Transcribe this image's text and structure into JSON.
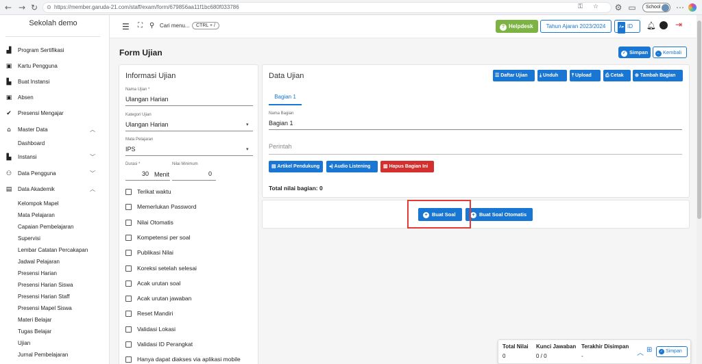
{
  "browser": {
    "url": "https://member.garuda-21.com/staff/exam/form/679856aa11f1bc680f033786",
    "profile_label": "School"
  },
  "sidebar": {
    "brand": "Sekolah demo",
    "items": [
      {
        "label": "Program Sertifikasi",
        "icon": "certificate-icon"
      },
      {
        "label": "Kartu Pengguna",
        "icon": "id-card-icon"
      },
      {
        "label": "Buat Instansi",
        "icon": "building-icon"
      },
      {
        "label": "Absen",
        "icon": "id-card-icon"
      },
      {
        "label": "Presensi Mengajar",
        "icon": "check-circle-icon"
      },
      {
        "label": "Master Data",
        "icon": "home-icon",
        "expanded": true
      },
      {
        "label": "Dashboard",
        "sub": true
      },
      {
        "label": "Instansi",
        "icon": "building-icon",
        "expanded": false
      },
      {
        "label": "Data Pengguna",
        "icon": "users-icon",
        "expanded": false
      },
      {
        "label": "Data Akademik",
        "icon": "book-icon",
        "expanded": true
      }
    ],
    "academic_sub": [
      "Kelompok Mapel",
      "Mata Pelajaran",
      "Capaian Pembelajaran",
      "Supervisi",
      "Lembar Catatan Percakapan",
      "Jadwal Pelajaran",
      "Presensi Harian",
      "Presensi Harian Siswa",
      "Presensi Harian Staff",
      "Presensi Mapel Siswa",
      "Materi Belajar",
      "Tugas Belajar",
      "Ujian",
      "Jurnal Pembelajaran"
    ]
  },
  "header": {
    "search_label": "Cari menu...",
    "shortcut": "CTRL + /",
    "helpdesk": "Helpdesk",
    "academic_year": "Tahun Ajaran 2023/2024",
    "lang": "ID"
  },
  "page": {
    "title": "Form Ujian",
    "save": "Simpan",
    "back": "Kembali"
  },
  "info": {
    "title": "Informasi Ujian",
    "nama_label": "Nama Ujian *",
    "nama_value": "Ulangan Harian",
    "kategori_label": "Kategori Ujian",
    "kategori_value": "Ulangan Harian",
    "mapel_label": "Mata Pelajaran",
    "mapel_value": "IPS",
    "durasi_label": "Durasi *",
    "durasi_value": "30",
    "durasi_unit": "Menit",
    "nilai_min_label": "Nilai Minimum",
    "nilai_min_value": "0",
    "checkboxes": [
      "Terikat waktu",
      "Memerlukan Password",
      "Nilai Otomatis",
      "Kompetensi per soal",
      "Publikasi Nilai",
      "Koreksi setelah selesai",
      "Acak urutan soal",
      "Acak urutan jawaban",
      "Reset Mandiri",
      "Validasi Lokasi",
      "Validasi ID Perangkat",
      "Hanya dapat diakses via aplikasi mobile"
    ]
  },
  "data_ujian": {
    "title": "Data Ujian",
    "actions": [
      "Daftar Ujian",
      "Unduh",
      "Upload",
      "Cetak",
      "Tambah Bagian"
    ],
    "tab": "Bagian 1",
    "bagian_label": "Nama Bagian",
    "bagian_value": "Bagian 1",
    "perintah_placeholder": "Perintah",
    "btn_artikel": "Artikel Pendukung",
    "btn_audio": "Audio Listening",
    "btn_hapus": "Hapus Bagian Ini",
    "total": "Total nilai bagian: 0",
    "buat_soal": "Buat Soal",
    "buat_soal_otomatis": "Buat Soal Otomatis"
  },
  "footer_panel": {
    "col1_label": "Total Nilai",
    "col1_value": "0",
    "col2_label": "Kunci Jawaban",
    "col2_value": "0 / 0",
    "col3_label": "Terakhir Disimpan",
    "col3_value": "-",
    "save": "Simpan"
  },
  "colors": {
    "primary": "#1976d2",
    "green": "#7cb342",
    "danger": "#d32f2f",
    "highlight": "#e53935"
  }
}
